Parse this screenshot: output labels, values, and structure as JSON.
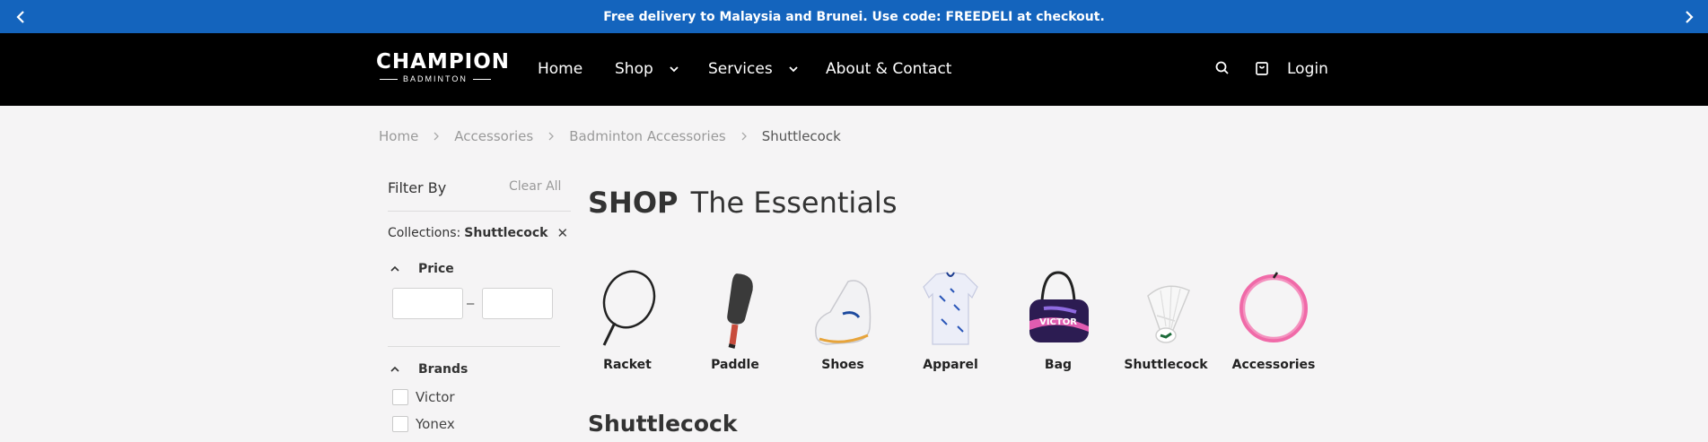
{
  "announcement": {
    "text": "Free delivery to Malaysia and Brunei. Use code: FREEDELI at checkout.",
    "prev_icon": "chevron-left-icon",
    "next_icon": "chevron-right-icon"
  },
  "header": {
    "logo_word": "CHAMPION",
    "logo_sub": "BADMINTON",
    "nav": [
      {
        "label": "Home"
      },
      {
        "label": "Shop"
      },
      {
        "label": "Services"
      },
      {
        "label": "About & Contact"
      }
    ],
    "search_icon": "search-icon",
    "cart_icon": "shopping-bag-icon",
    "login_label": "Login"
  },
  "breadcrumb": [
    "Home",
    "Accessories",
    "Badminton Accessories",
    "Shuttlecock"
  ],
  "filter": {
    "title": "Filter By",
    "clear_all": "Clear All",
    "collections_label": "Collections:",
    "collections_value": "Shuttlecock",
    "price_label": "Price",
    "price_min": "",
    "price_max": "",
    "price_separator": "–",
    "brands_label": "Brands",
    "brands": [
      "Victor",
      "Yonex"
    ]
  },
  "main": {
    "heading_bold": "SHOP",
    "heading_rest": "The Essentials",
    "categories": [
      {
        "label": "Racket"
      },
      {
        "label": "Paddle"
      },
      {
        "label": "Shoes"
      },
      {
        "label": "Apparel"
      },
      {
        "label": "Bag"
      },
      {
        "label": "Shuttlecock"
      },
      {
        "label": "Accessories"
      }
    ],
    "section_title": "Shuttlecock"
  },
  "colors": {
    "announcement_bg": "#1464bd",
    "header_bg": "#000000",
    "page_bg": "#f5f4f5"
  }
}
